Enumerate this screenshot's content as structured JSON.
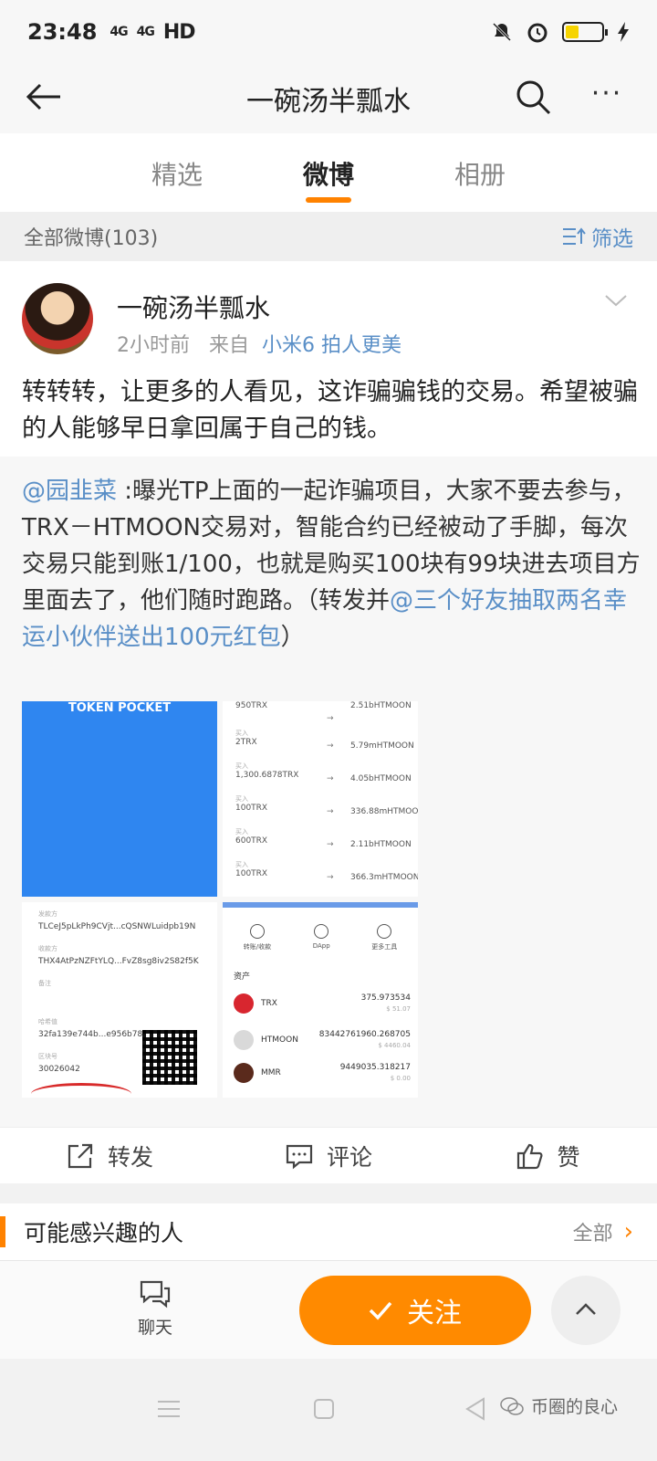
{
  "status": {
    "time": "23:48",
    "signal1": "4G",
    "signal2": "4G",
    "hd": "HD"
  },
  "header": {
    "title": "一碗汤半瓢水",
    "back_icon": "back-arrow-icon",
    "search_icon": "search-icon",
    "more_label": "···"
  },
  "tabs": [
    {
      "label": "精选"
    },
    {
      "label": "微博"
    },
    {
      "label": "相册"
    }
  ],
  "filterbar": {
    "label": "全部微博(103)",
    "filter_label": "筛选"
  },
  "post": {
    "author": "一碗汤半瓢水",
    "time": "2小时前",
    "from_prefix": "来自",
    "source": "小米6 拍人更美",
    "text": "转转转，让更多的人看见，这诈骗骗钱的交易。希望被骗的人能够早日拿回属于自己的钱。",
    "repost": {
      "at_user": "@园韭菜",
      "text_a": " :曝光TP上面的一起诈骗项目，大家不要去参与，TRX－HTMOON交易对，智能合约已经被动了手脚，每次交易只能到账1/100，也就是购买100块有99块进去项目方里面去了，他们随时跑路。（转发并",
      "at_link": "@三个好友抽取两名幸运小伙伴送出100元红包",
      "text_b": "）"
    },
    "images": {
      "img1_label": "TOKEN POCKET",
      "tx_rows": [
        {
          "in": "950TRX",
          "out": "2.51bHTMOON",
          "buy": ""
        },
        {
          "in": "2TRX",
          "out": "5.79mHTMOON",
          "buy": "买入"
        },
        {
          "in": "1,300.6878TRX",
          "out": "4.05bHTMOON",
          "buy": "买入"
        },
        {
          "in": "100TRX",
          "out": "336.88mHTMOON",
          "buy": "买入"
        },
        {
          "in": "600TRX",
          "out": "2.11bHTMOON",
          "buy": "买入"
        },
        {
          "in": "100TRX",
          "out": "366.3mHTMOON",
          "buy": "买入"
        }
      ],
      "detail": {
        "l1": "发款方",
        "v1": "TLCeJ5pLkPh9CVjt...cQSNWLuidpb19N",
        "l2": "收款方",
        "v2": "THX4AtPzNZFtYLQ...FvZ8sg8iv2S82f5K",
        "l3": "备注",
        "l4": "哈希值",
        "v4": "32fa139e744b...e956b78a0870",
        "l5": "区块号",
        "v5": "30026042"
      },
      "wallet": {
        "w1": "转账/收款",
        "w2": "DApp",
        "w3": "更多工具",
        "assets_label": "资产",
        "assets": [
          {
            "name": "TRX",
            "amount": "375.973534",
            "usd": "$ 51.07",
            "color": "#d8262f"
          },
          {
            "name": "HTMOON",
            "amount": "83442761960.268705",
            "usd": "$ 4460.04",
            "color": "#d9d9d9"
          },
          {
            "name": "MMR",
            "amount": "9449035.318217",
            "usd": "$ 0.00",
            "color": "#5a2a1c"
          }
        ]
      }
    }
  },
  "actions": {
    "repost": "转发",
    "comment": "评论",
    "like": "赞"
  },
  "suggest": {
    "title": "可能感兴趣的人",
    "all": "全部",
    "chevron": "›"
  },
  "bottom": {
    "chat": "聊天",
    "follow": "关注"
  },
  "watermark": "币圈的良心",
  "colors": {
    "accent": "#ff8200",
    "link": "#5a8fc7",
    "follow_bg": "#ff8a00"
  }
}
